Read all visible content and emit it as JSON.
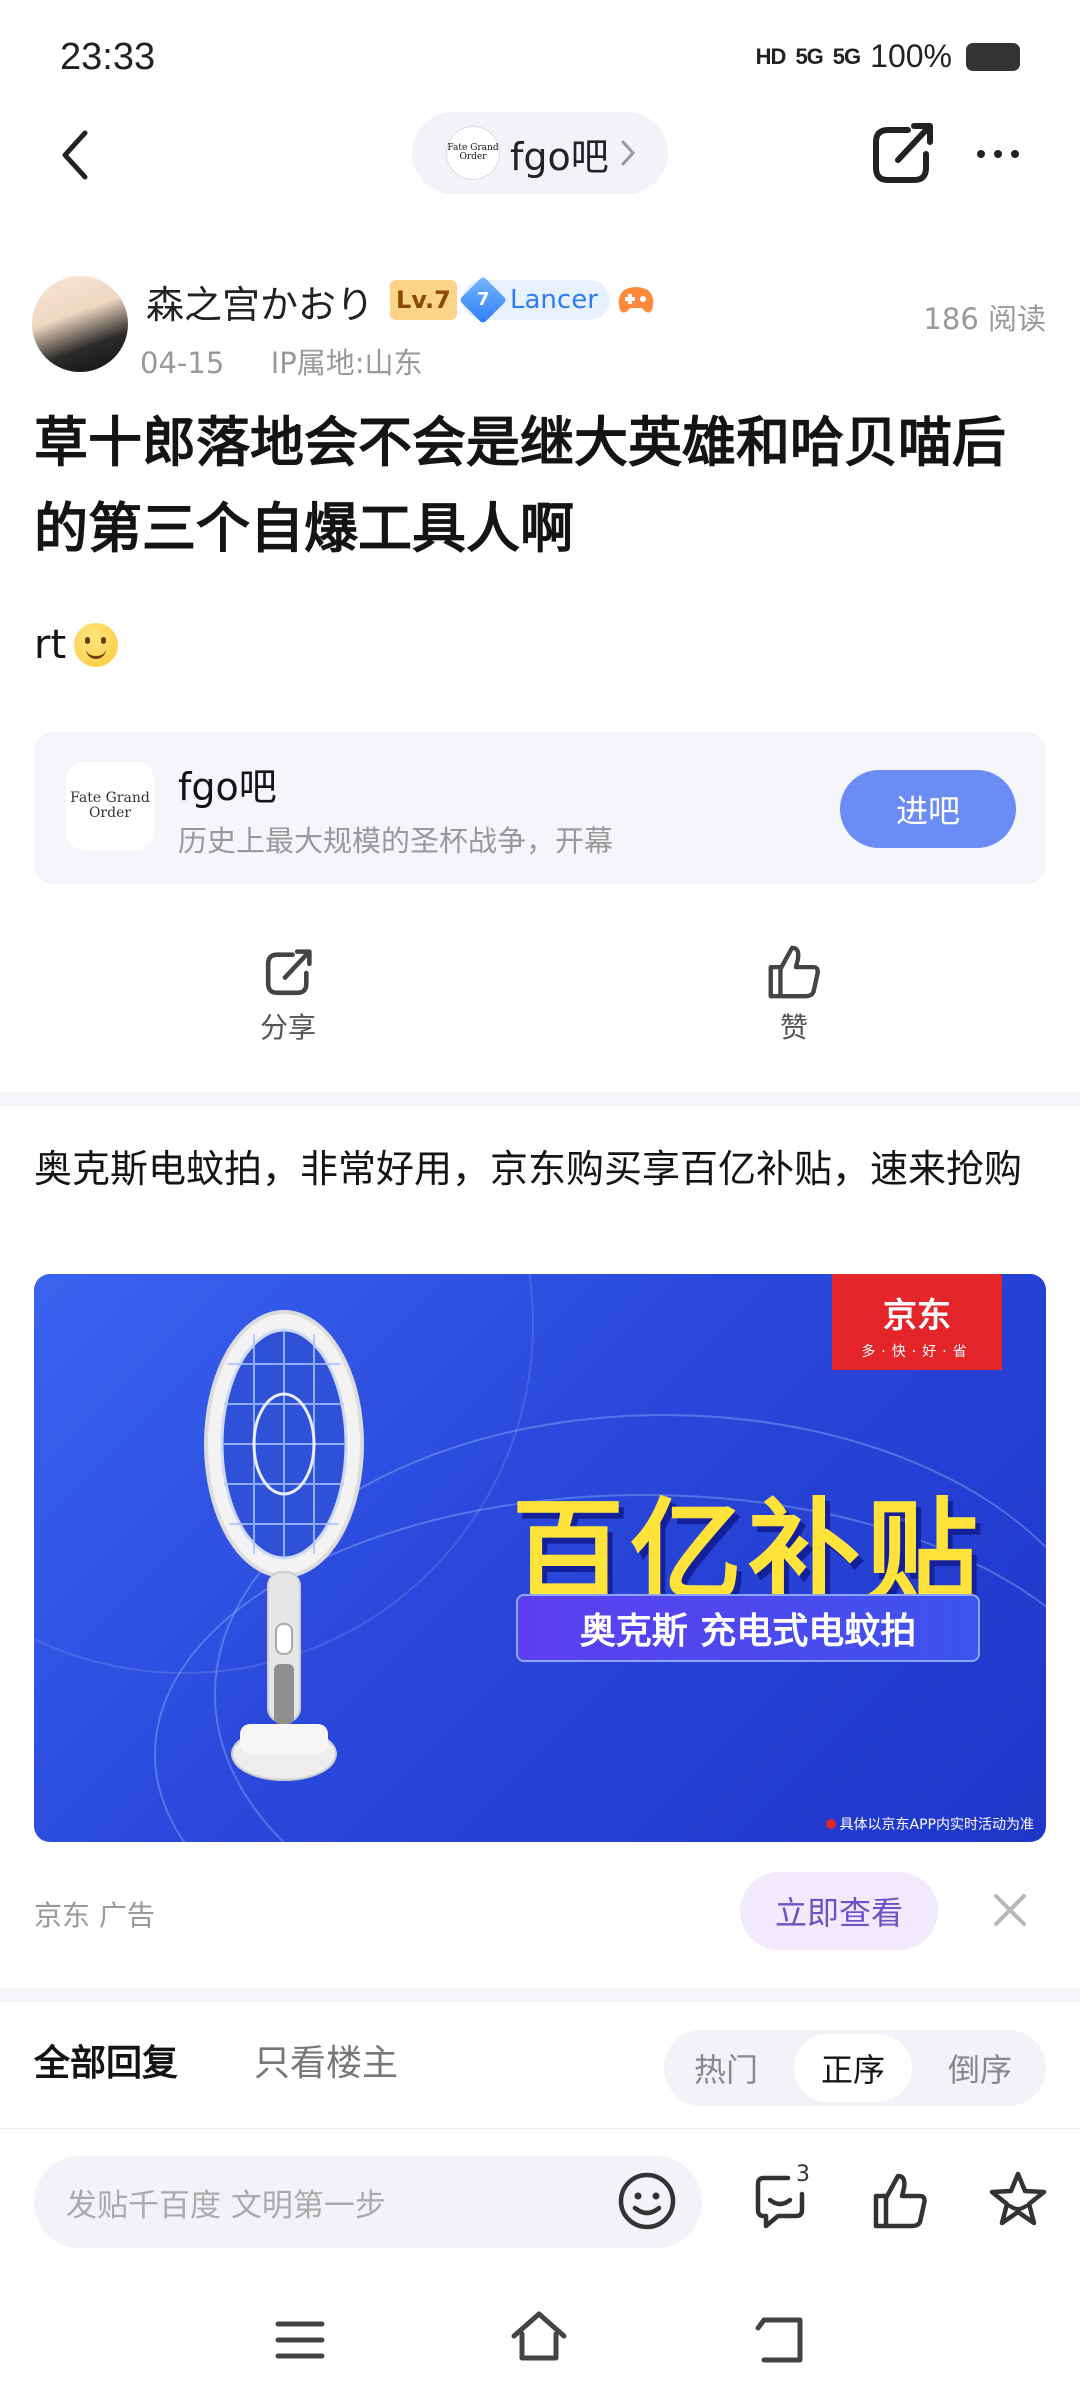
{
  "status_bar": {
    "time": "23:33",
    "network_1": "HD",
    "network_2": "5G",
    "network_3": "5G",
    "battery": "100%"
  },
  "nav": {
    "forum_name": "fgo吧",
    "forum_logo_text": "Fate Grand Order"
  },
  "post": {
    "author": "森之宫かおり",
    "level": "Lv.7",
    "badge_number": "7",
    "badge_class": "Lancer",
    "date": "04-15",
    "ip": "IP属地:山东",
    "read_count": "186 阅读",
    "title": "草十郎落地会不会是继大英雄和哈贝喵后的第三个自爆工具人啊",
    "body": "rt"
  },
  "forum_card": {
    "name": "fgo吧",
    "description": "历史上最大规模的圣杯战争，开幕",
    "join_label": "进吧",
    "logo_text": "Fate Grand Order"
  },
  "actions": {
    "share_label": "分享",
    "like_label": "赞"
  },
  "ad": {
    "text": "奥克斯电蚊拍，非常好用，京东购买享百亿补贴，速来抢购",
    "brand_badge": "京东",
    "brand_slogan": "多·快·好·省",
    "headline": "百亿补贴",
    "subheadline": "奥克斯 充电式电蚊拍",
    "disclaimer": "具体以京东APP内实时活动为准",
    "source": "京东  广告",
    "view_label": "立即查看"
  },
  "replies": {
    "tab_all": "全部回复",
    "tab_owner": "只看楼主",
    "sort_hot": "热门",
    "sort_asc": "正序",
    "sort_desc": "倒序"
  },
  "bottom_bar": {
    "placeholder": "发贴千百度 文明第一步",
    "comment_count": "3"
  },
  "colors": {
    "accent": "#6b8cf5",
    "ad_bg": "#2a48db",
    "headline_yellow": "#ffe33a",
    "jd_red": "#e4262b"
  }
}
